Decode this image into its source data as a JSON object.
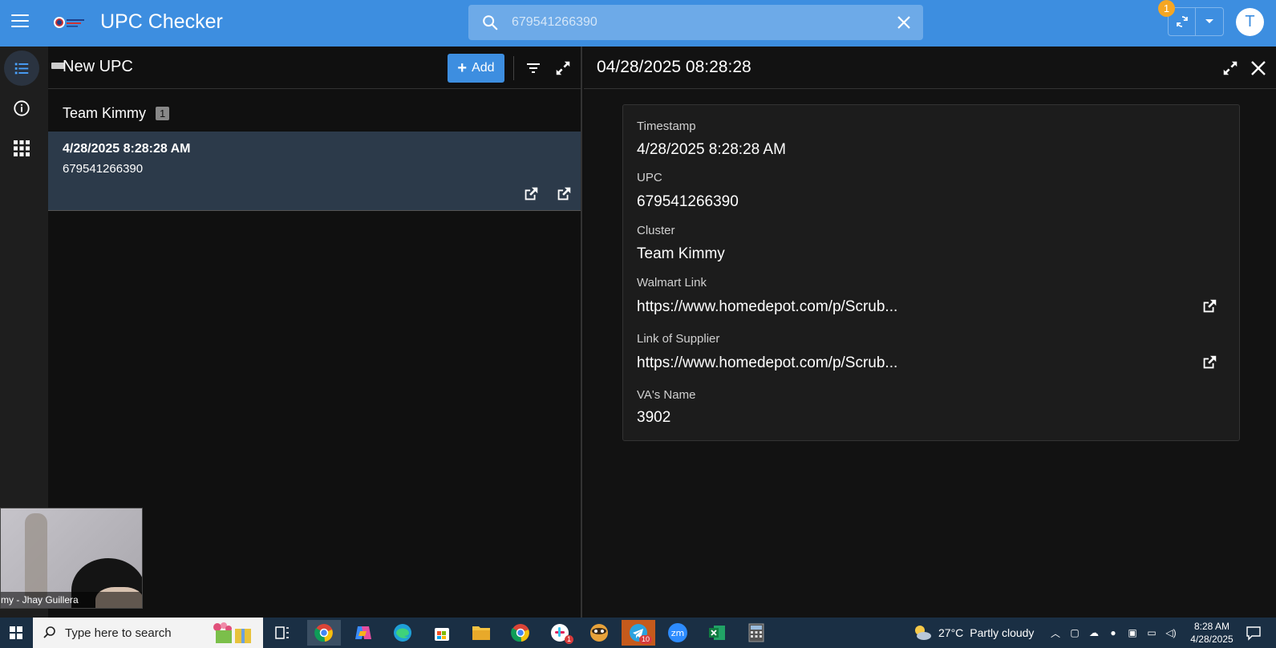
{
  "header": {
    "app_title": "UPC Checker",
    "search_value": "679541266390",
    "sync_badge": "1",
    "avatar_letter": "T",
    "accent": "#3d8ee0"
  },
  "rail": {
    "items": [
      {
        "icon": "list-icon",
        "active": true
      },
      {
        "icon": "info-icon",
        "active": false
      },
      {
        "icon": "apps-grid-icon",
        "active": false
      }
    ]
  },
  "list_panel": {
    "title": "New UPC",
    "add_label": "Add",
    "group": {
      "name": "Team Kimmy",
      "count": "1"
    },
    "rows": [
      {
        "timestamp": "4/28/2025 8:28:28 AM",
        "upc": "679541266390"
      }
    ]
  },
  "detail_panel": {
    "title": "04/28/2025 08:28:28",
    "fields": [
      {
        "label": "Timestamp",
        "value": "4/28/2025 8:28:28 AM"
      },
      {
        "label": "UPC",
        "value": "679541266390"
      },
      {
        "label": "Cluster",
        "value": "Team Kimmy"
      },
      {
        "label": "Walmart Link",
        "value": "https://www.homedepot.com/p/Scrub..."
      },
      {
        "label": "Link of Supplier",
        "value": "https://www.homedepot.com/p/Scrub..."
      },
      {
        "label": "VA's Name",
        "value": "3902"
      }
    ]
  },
  "webcam": {
    "label": "my - Jhay Guillera"
  },
  "taskbar": {
    "search_placeholder": "Type here to search",
    "weather_temp": "27°C",
    "weather_text": "Partly cloudy",
    "clock_time": "8:28 AM",
    "clock_date": "4/28/2025",
    "badge_slack": "1",
    "badge_telegram": "10"
  }
}
